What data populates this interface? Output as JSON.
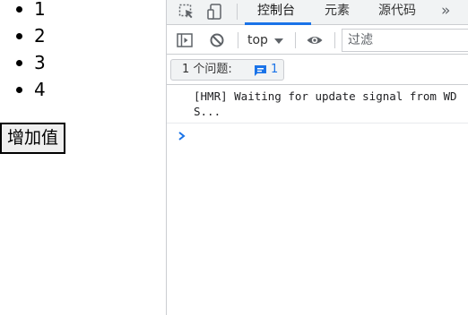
{
  "page": {
    "items": [
      "1",
      "2",
      "3",
      "4"
    ],
    "button_label": "增加值"
  },
  "devtools": {
    "icons": [
      "inspect-element-icon",
      "device-toolbar-icon",
      "sidebar-toggle-icon",
      "clear-console-icon",
      "eye-icon",
      "issue-message-icon",
      "console-prompt-icon"
    ],
    "tabs": [
      {
        "label": "控制台",
        "active": true
      },
      {
        "label": "元素",
        "active": false
      },
      {
        "label": "源代码",
        "active": false
      }
    ],
    "more_tabs": "»",
    "context": "top",
    "filter_placeholder": "过滤",
    "issues_label": "1 个问题:",
    "issues_count": "1",
    "console_message": "[HMR] Waiting for update signal from WDS...",
    "colors": {
      "accent": "#1a73e8",
      "border": "#cbcdd1",
      "toolbar_bg": "#f1f3f4"
    }
  }
}
